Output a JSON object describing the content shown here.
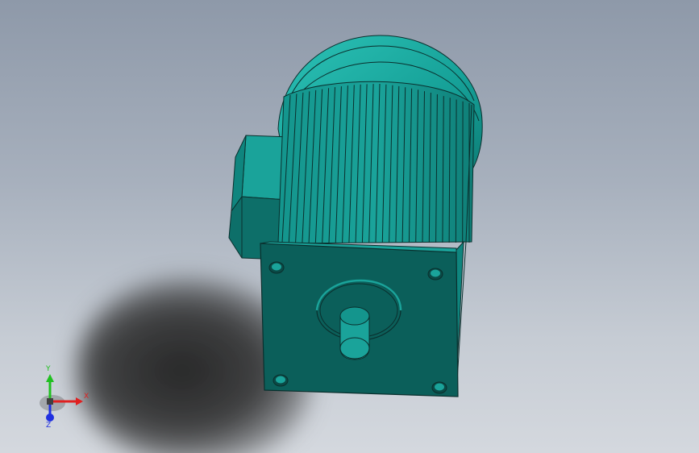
{
  "viewport": {
    "background_top": "#8e99a9",
    "background_bottom": "#d4d8de"
  },
  "model": {
    "body_color": "#1aa39a",
    "flange_color": "#0b5f5a",
    "edge_color": "#0a2f2d"
  },
  "triad": {
    "x_label": "X",
    "y_label": "Y",
    "z_label": "Z",
    "x_color": "#e02020",
    "y_color": "#20c020",
    "z_color": "#2030e0"
  }
}
